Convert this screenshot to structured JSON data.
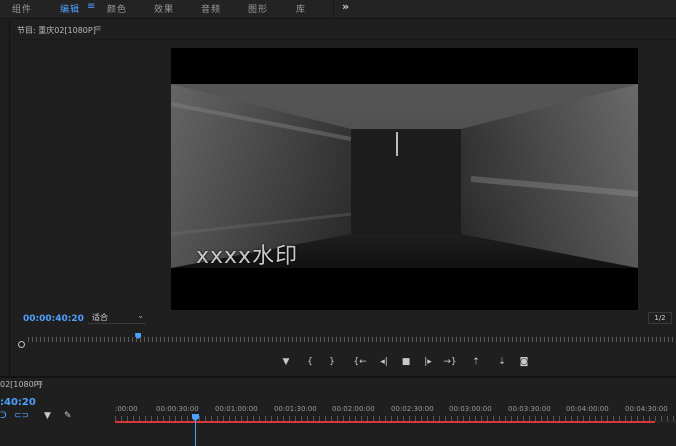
{
  "workspace": {
    "tabs": [
      {
        "label": "组件",
        "active": false
      },
      {
        "label": "编辑",
        "active": true
      },
      {
        "label": "颜色",
        "active": false
      },
      {
        "label": "效果",
        "active": false
      },
      {
        "label": "音频",
        "active": false
      },
      {
        "label": "图形",
        "active": false
      },
      {
        "label": "库",
        "active": false
      }
    ],
    "menu_glyph": "≡",
    "more_glyph": "»"
  },
  "program": {
    "title": "节目: 重庆02[1080P]",
    "menu_glyph": "≡",
    "watermark": "xxxx水印",
    "timecode": "00:00:40:20",
    "zoom": "适合",
    "resolution": "1/2",
    "playhead_fraction": 0.17
  },
  "controls": [
    {
      "name": "add-marker",
      "glyph": "▼"
    },
    {
      "name": "mark-in",
      "glyph": "{"
    },
    {
      "name": "mark-out",
      "glyph": "}"
    },
    {
      "name": "go-to-in",
      "glyph": "{←"
    },
    {
      "name": "step-back",
      "glyph": "◂|"
    },
    {
      "name": "stop",
      "glyph": "■"
    },
    {
      "name": "step-forward",
      "glyph": "|▸"
    },
    {
      "name": "go-to-out",
      "glyph": "→}"
    },
    {
      "name": "lift",
      "glyph": "⇡"
    },
    {
      "name": "extract",
      "glyph": "⇣"
    },
    {
      "name": "export-frame",
      "glyph": "◙"
    }
  ],
  "timeline": {
    "tab_label": "02[1080P]",
    "menu_glyph": "≡",
    "timecode": ":40:20",
    "ruler": [
      ":00:00",
      "00:00:30:00",
      "00:01:00:00",
      "00:01:30:00",
      "00:02:00:00",
      "00:02:30:00",
      "00:03:00:00",
      "00:03:30:00",
      "00:04:00:00",
      "00:04:30:00"
    ],
    "colors": {
      "accent": "#4ea0ff",
      "in_out_bar": "#d8383a"
    }
  }
}
